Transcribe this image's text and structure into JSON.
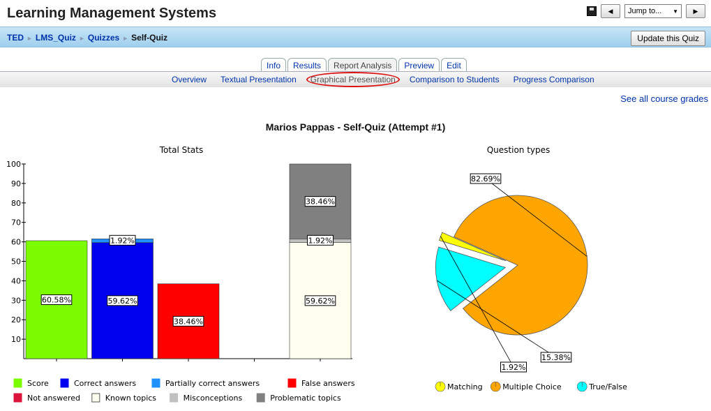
{
  "header": {
    "site_title": "Learning Management Systems",
    "jump_label": "Jump to...",
    "prev_icon": "triangle-left-icon",
    "next_icon": "triangle-right-icon",
    "save_icon": "floppy-icon"
  },
  "breadcrumb": {
    "items": [
      "TED",
      "LMS_Quiz",
      "Quizzes",
      "Self-Quiz"
    ],
    "separator": "►"
  },
  "update_button": "Update this Quiz",
  "tabs": [
    "Info",
    "Results",
    "Report Analysis",
    "Preview",
    "Edit"
  ],
  "active_tab": "Report Analysis",
  "subtabs": [
    "Overview",
    "Textual Presentation",
    "Graphical Presentation",
    "Comparison to Students",
    "Progress Comparison"
  ],
  "selected_subtab": "Graphical Presentation",
  "grades_link": "See all course grades",
  "page_heading": "Marios Pappas - Self-Quiz (Attempt #1)",
  "chart_data": [
    {
      "type": "bar",
      "title": "Total Stats",
      "ylim": [
        0,
        100
      ],
      "yticks": [
        "100",
        "90",
        "80",
        "70",
        "60",
        "50",
        "40",
        "30",
        "20",
        "10"
      ],
      "grid": false,
      "bars": [
        {
          "segments": [
            {
              "series": "Score",
              "value": 60.58,
              "label": "60.58%"
            }
          ]
        },
        {
          "segments": [
            {
              "series": "Correct answers",
              "value": 59.62,
              "label": "59.62%"
            },
            {
              "series": "Partially correct answers",
              "value": 1.92,
              "label": "1.92%"
            }
          ]
        },
        {
          "segments": [
            {
              "series": "False answers",
              "value": 38.46,
              "label": "38.46%"
            }
          ]
        },
        {
          "segments": []
        },
        {
          "segments": [
            {
              "series": "Known topics",
              "value": 59.62,
              "label": "59.62%"
            },
            {
              "series": "Misconceptions",
              "value": 1.92,
              "label": "1.92%"
            },
            {
              "series": "Problematic topics",
              "value": 38.46,
              "label": "38.46%"
            }
          ]
        }
      ],
      "legend": [
        {
          "name": "Score",
          "color": "#7cfc00"
        },
        {
          "name": "Correct answers",
          "color": "#0000ee"
        },
        {
          "name": "Partially correct answers",
          "color": "#1e90ff"
        },
        {
          "name": "False answers",
          "color": "#ff0000"
        },
        {
          "name": "Not answered",
          "color": "#dc143c"
        },
        {
          "name": "Known topics",
          "color": "#fffff0"
        },
        {
          "name": "Misconceptions",
          "color": "#c0c0c0"
        },
        {
          "name": "Problematic topics",
          "color": "#808080"
        }
      ],
      "legend_placement": "bottom"
    },
    {
      "type": "pie",
      "title": "Question types",
      "slices": [
        {
          "name": "Multiple Choice",
          "value": 82.69,
          "label": "82.69%",
          "color": "#ffa500",
          "exploded": false
        },
        {
          "name": "True/False",
          "value": 15.38,
          "label": "15.38%",
          "color": "#00ffff",
          "exploded": true
        },
        {
          "name": "Matching",
          "value": 1.92,
          "label": "1.92%",
          "color": "#ffff00",
          "exploded": true
        }
      ],
      "legend_order": [
        "Matching",
        "Multiple Choice",
        "True/False"
      ],
      "legend_placement": "bottom"
    }
  ]
}
